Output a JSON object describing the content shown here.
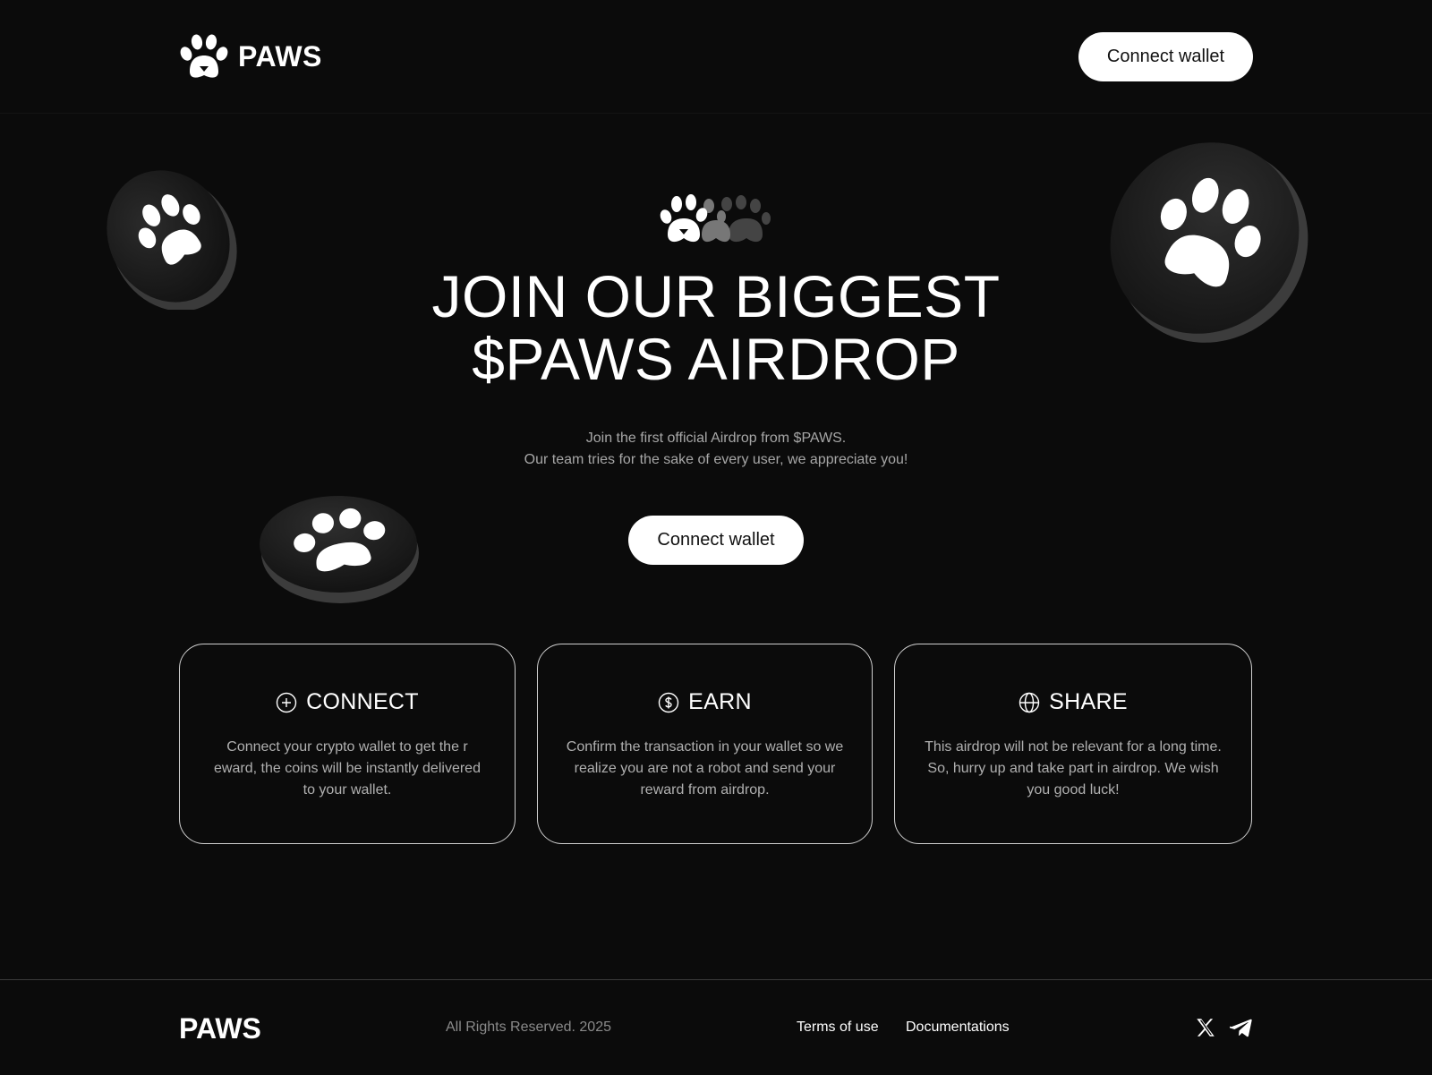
{
  "header": {
    "logo_text": "PAWS",
    "connect_label": "Connect wallet"
  },
  "hero": {
    "title_line1": "JOIN OUR BIGGEST",
    "title_line2": "$PAWS AIRDROP",
    "subtitle_line1": "Join the first official Airdrop from $PAWS.",
    "subtitle_line2": "Our team tries for the sake of every user, we appreciate you!",
    "connect_label": "Connect wallet"
  },
  "cards": [
    {
      "icon": "plus-circle-icon",
      "title": "CONNECT",
      "text": "Connect your crypto wallet to get the r eward, the coins will be instantly delivered to your wallet."
    },
    {
      "icon": "dollar-circle-icon",
      "title": "EARN",
      "text": "Confirm the transaction in your wallet so we realize you are not a robot and send your reward from airdrop."
    },
    {
      "icon": "globe-icon",
      "title": "SHARE",
      "text": "This airdrop will not be relevant for a long time. So, hurry up and take part in airdrop. We wish you good luck!"
    }
  ],
  "footer": {
    "logo_text": "PAWS",
    "rights": "All Rights Reserved. 2025",
    "links": [
      "Terms of use",
      "Documentations"
    ],
    "socials": [
      "x-icon",
      "telegram-icon"
    ]
  },
  "colors": {
    "background": "#0b0b0b",
    "text": "#ffffff",
    "muted": "#a7a7a7",
    "button_bg": "#ffffff",
    "button_text": "#111111"
  }
}
